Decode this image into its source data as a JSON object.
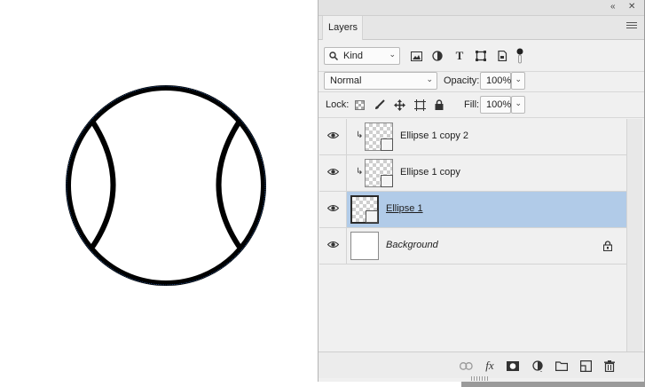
{
  "panel": {
    "tab_label": "Layers",
    "collapse_icon": "double-chevron-left-icon",
    "close_icon": "close-icon",
    "menu_icon": "hamburger-menu-icon"
  },
  "filter": {
    "kind_label": "Kind",
    "icons": [
      "image-filter-icon",
      "adjustment-filter-icon",
      "type-filter-icon",
      "shape-filter-icon",
      "smart-object-filter-icon",
      "filter-toggle-icon"
    ]
  },
  "blend": {
    "mode": "Normal",
    "opacity_label": "Opacity:",
    "opacity_value": "100%"
  },
  "lock": {
    "label": "Lock:",
    "icons": [
      "lock-transparent-pixels-icon",
      "lock-image-pixels-icon",
      "lock-position-icon",
      "lock-artboard-icon",
      "lock-all-icon"
    ],
    "fill_label": "Fill:",
    "fill_value": "100%"
  },
  "layers": [
    {
      "name": "Ellipse 1 copy 2",
      "clipped": true,
      "selected": false
    },
    {
      "name": "Ellipse 1 copy",
      "clipped": true,
      "selected": false
    },
    {
      "name": "Ellipse 1",
      "clipped": false,
      "selected": true
    },
    {
      "name": "Background",
      "clipped": false,
      "selected": false,
      "locked": true
    }
  ],
  "footer": {
    "fx_label": "fx",
    "icons": [
      "link-layers-icon",
      "layer-style-icon",
      "layer-mask-icon",
      "adjustment-layer-icon",
      "group-folder-icon",
      "new-layer-icon",
      "trash-icon"
    ]
  },
  "colors": {
    "selection": "#b1cbe8",
    "panel_bg": "#f0f0f0",
    "artwork_stroke": "#000000"
  }
}
